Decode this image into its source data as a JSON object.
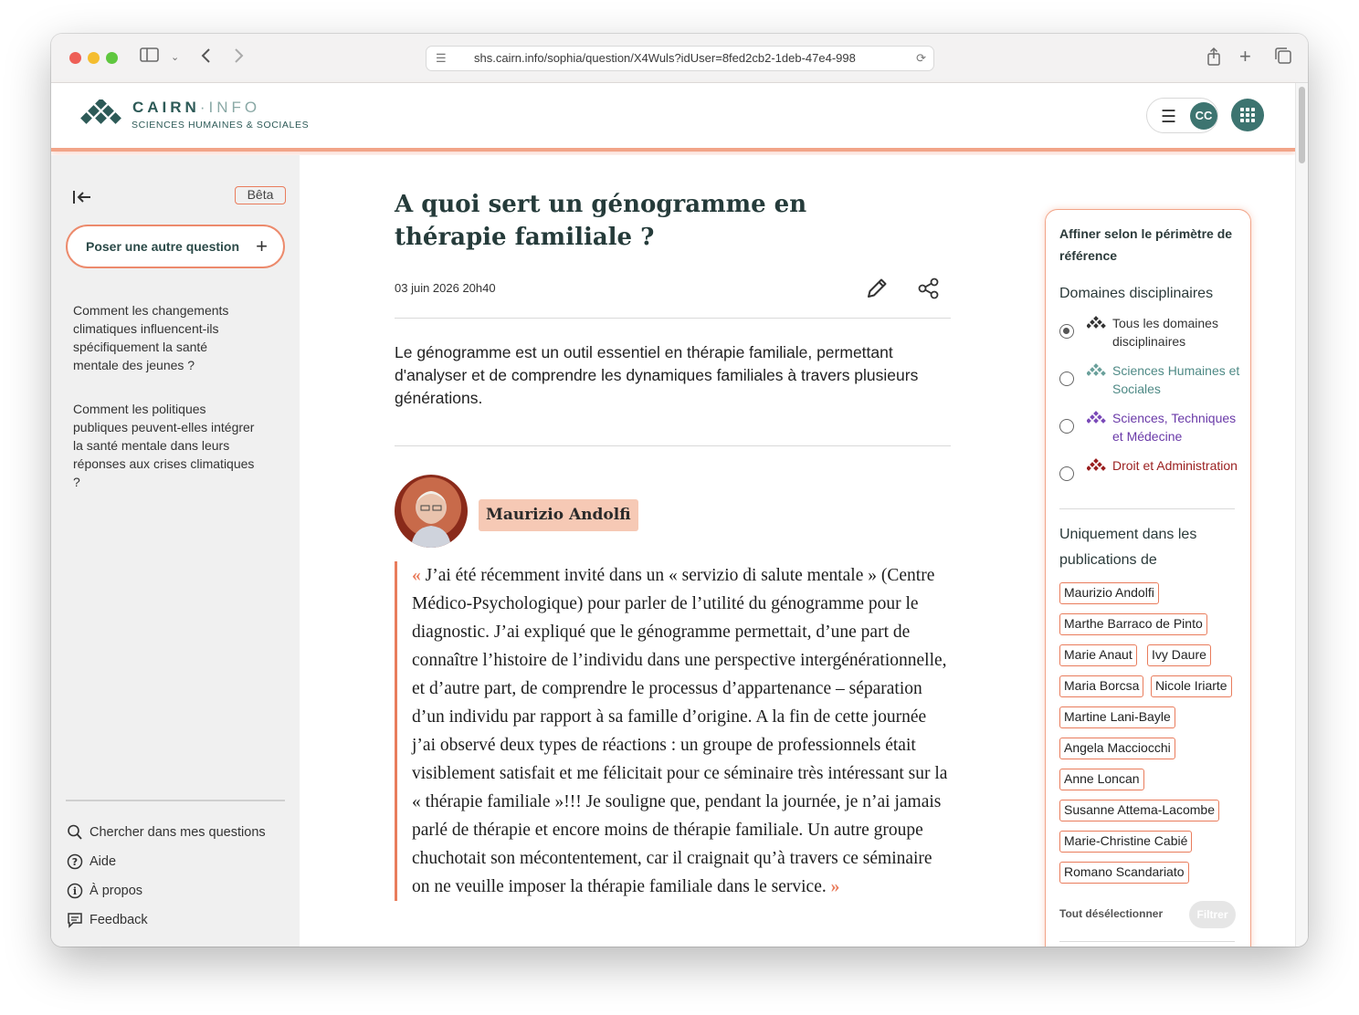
{
  "browser": {
    "url": "shs.cairn.info/sophia/question/X4Wuls?idUser=8fed2cb2-1deb-47e4-998"
  },
  "header": {
    "logo_title": "CAIRN",
    "logo_title_sep": "·",
    "logo_title_info": "INFO",
    "logo_subtitle": "SCIENCES HUMAINES & SOCIALES",
    "avatar_initials": "CC"
  },
  "sidebar": {
    "beta_label": "Bêta",
    "ask_button_label": "Poser une autre question",
    "history": [
      "Comment les changements climatiques influencent-ils spécifiquement la santé mentale des jeunes ?",
      "Comment les politiques publiques peuvent-elles intégrer la santé mentale dans leurs réponses aux crises climatiques ?"
    ],
    "links": [
      {
        "label": "Chercher dans mes questions",
        "icon": "search-icon"
      },
      {
        "label": "Aide",
        "icon": "help-icon"
      },
      {
        "label": "À propos",
        "icon": "info-icon"
      },
      {
        "label": "Feedback",
        "icon": "feedback-icon"
      }
    ]
  },
  "main": {
    "title": "A quoi sert un génogramme en thérapie familiale ?",
    "date": "03 juin 2026 20h40",
    "summary": "Le génogramme est un outil essentiel en thérapie familiale, permettant d'analyser et de comprendre les dynamiques familiales à travers plusieurs générations.",
    "author": "Maurizio Andolfi",
    "quote_open": "«",
    "quote_close": "»",
    "quote": "J’ai été récemment invité dans un « servizio di salute mentale » (Centre Médico-Psychologique) pour parler de l’utilité du génogramme pour le diagnostic. J’ai expliqué que le génogramme permettait, d’une part de connaître l’histoire de l’individu dans une perspective intergénérationnelle, et d’autre part, de comprendre le processus d’appartenance – séparation d’un individu par rapport à sa famille d’origine. A la fin de cette journée j’ai observé deux types de réactions : un groupe de professionnels était visiblement satisfait et me félicitait pour ce séminaire très intéressant sur la « thérapie familiale »!!! Je souligne que, pendant la journée, je n’ai jamais parlé de thérapie et encore moins de thérapie familiale. Un autre groupe chuchotait son mécontentement, car il craignait qu’à travers ce séminaire on ne veuille imposer la thérapie familiale dans le service."
  },
  "filter": {
    "title": "Affiner selon le périmètre de référence",
    "domains_heading": "Domaines disciplinaires",
    "domains": [
      {
        "label": "Tous les domaines disciplinaires",
        "color": "#333333",
        "checked": true
      },
      {
        "label": "Sciences Humaines et Sociales",
        "color": "#4f8a86",
        "checked": false
      },
      {
        "label": "Sciences, Techniques et Médecine",
        "color": "#6a3aa8",
        "checked": false
      },
      {
        "label": "Droit et Administration",
        "color": "#9a1f1f",
        "checked": false
      }
    ],
    "publications_heading": "Uniquement dans les publications de",
    "authors": [
      "Maurizio Andolfi",
      "Marthe Barraco de Pinto",
      "Marie Anaut",
      "Ivy Daure",
      "Maria Borcsa",
      "Nicole Iriarte",
      "Martine Lani-Bayle",
      "Angela Macciocchi",
      "Anne Loncan",
      "Susanne Attema-Lacombe",
      "Marie-Christine Cabié",
      "Romano Scandariato"
    ],
    "deselect_label": "Tout désélectionner",
    "filter_button": "Filtrer"
  },
  "colors": {
    "accent": "#e97c5c",
    "brand": "#3d7470"
  }
}
